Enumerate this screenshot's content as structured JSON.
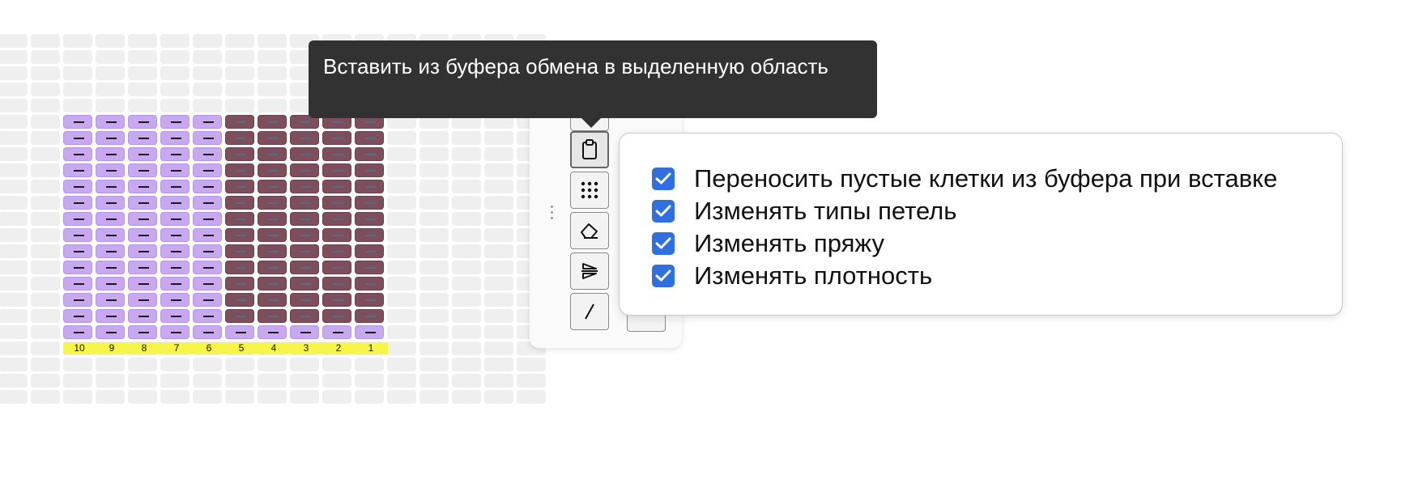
{
  "chart": {
    "columns": 10,
    "rows": 14,
    "light_columns": [
      10,
      9,
      8,
      7,
      6
    ],
    "dark_columns": [
      5,
      4,
      3,
      2,
      1
    ],
    "column_numbers": [
      "10",
      "9",
      "8",
      "7",
      "6",
      "5",
      "4",
      "3",
      "2",
      "1"
    ],
    "colors": {
      "stitch_light": "#c8a8ef",
      "stitch_dark": "#7d4f5c",
      "number_row": "#f5f54a",
      "background_cell": "#efefef"
    }
  },
  "tooltip": {
    "text": "Вставить из буфера обмена в выделенную область"
  },
  "toolbar": {
    "tools": [
      {
        "name": "paste",
        "icon": "clipboard-icon",
        "active": true
      },
      {
        "name": "select-pattern",
        "icon": "dot-grid-icon",
        "active": false
      },
      {
        "name": "erase",
        "icon": "eraser-icon",
        "active": false
      },
      {
        "name": "mirror",
        "icon": "mirror-icon",
        "active": false
      },
      {
        "name": "line",
        "icon": "line-icon",
        "active": false
      }
    ]
  },
  "paste_options": {
    "items": [
      {
        "label": "Переносить пустые клетки из буфера при вставке",
        "checked": true
      },
      {
        "label": "Изменять типы петель",
        "checked": true
      },
      {
        "label": "Изменять пряжу",
        "checked": true
      },
      {
        "label": "Изменять плотность",
        "checked": true
      }
    ],
    "accent": "#2f6fdf"
  }
}
